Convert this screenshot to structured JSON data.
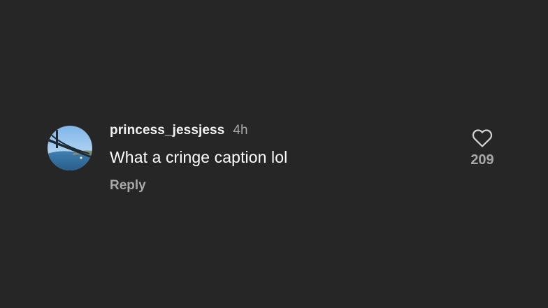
{
  "comment": {
    "avatar_icon": "golden-gate-bridge-photo",
    "username": "princess_jessjess",
    "time": "4h",
    "text": "What a cringe caption lol",
    "reply_label": "Reply",
    "like_icon": "heart-outline-icon",
    "like_count": "209"
  },
  "colors": {
    "background": "#262626",
    "primary_text": "#ffffff",
    "secondary_text": "#a8a8a8"
  }
}
